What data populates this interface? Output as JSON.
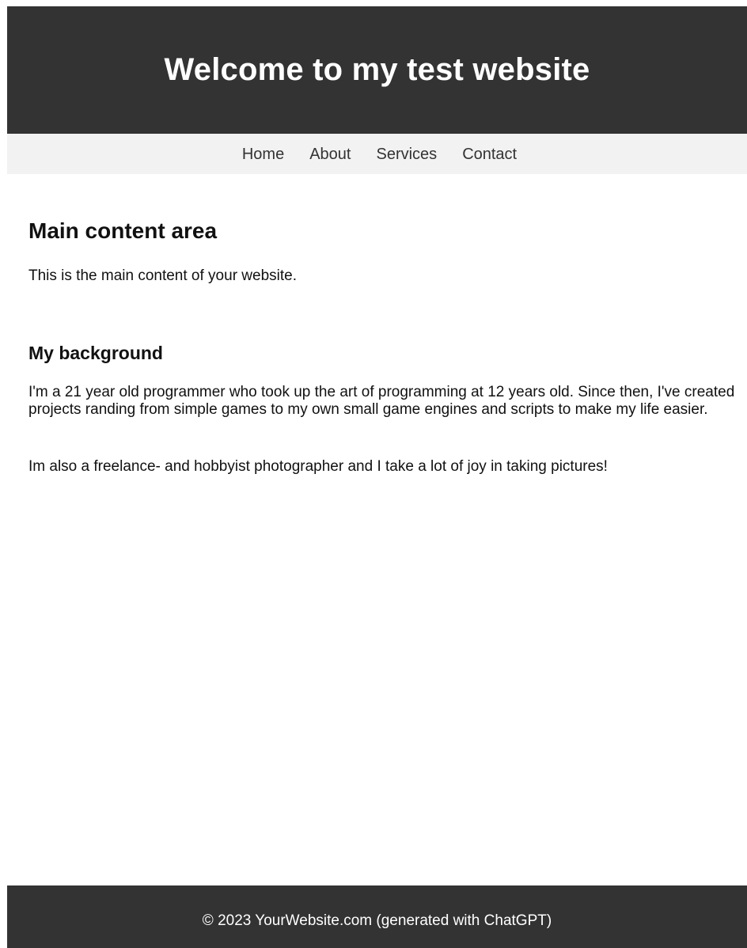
{
  "header": {
    "title": "Welcome to my test website"
  },
  "nav": {
    "items": [
      {
        "label": "Home"
      },
      {
        "label": "About"
      },
      {
        "label": "Services"
      },
      {
        "label": "Contact"
      }
    ]
  },
  "main": {
    "heading": "Main content area",
    "intro": "This is the main content of your website.",
    "background_heading": "My background",
    "background_paragraphs": [
      "I'm a 21 year old programmer who took up the art of programming at 12 years old. Since then, I've created projects randing from simple games to my own small game engines and scripts to make my life easier.",
      "Im also a freelance- and hobbyist photographer and I take a lot of joy in taking pictures!"
    ]
  },
  "footer": {
    "text": "© 2023 YourWebsite.com (generated with ChatGPT)"
  },
  "colors": {
    "header_bg": "#333333",
    "nav_bg": "#f2f2f2",
    "footer_bg": "#333333",
    "nav_text": "#333333"
  }
}
